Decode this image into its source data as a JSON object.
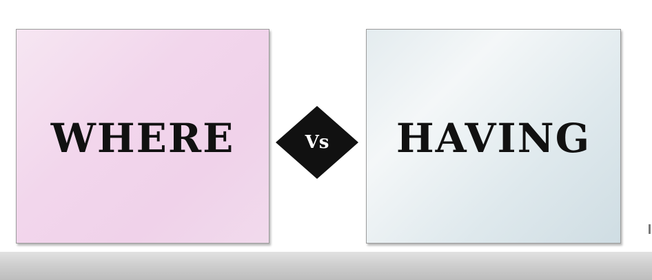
{
  "left_card": {
    "label": "WHERE",
    "color": "#f2d6ec"
  },
  "right_card": {
    "label": "HAVING",
    "color": "#dfe9ed"
  },
  "separator": {
    "label": "Vs",
    "color": "#111111"
  }
}
